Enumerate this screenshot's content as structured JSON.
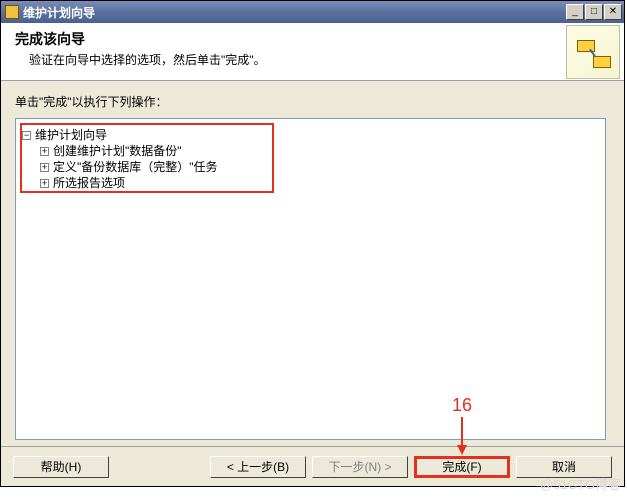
{
  "window": {
    "title": "维护计划向导"
  },
  "header": {
    "title": "完成该向导",
    "subtitle": "验证在向导中选择的选项，然后单击\"完成\"。"
  },
  "instruction": "单击\"完成\"以执行下列操作：",
  "tree": {
    "root": "维护计划向导",
    "items": [
      "创建维护计划\"数据备份\"",
      "定义\"备份数据库（完整）\"任务",
      "所选报告选项"
    ]
  },
  "buttons": {
    "help": "帮助(H)",
    "back": "< 上一步(B)",
    "next": "下一步(N) >",
    "finish": "完成(F)",
    "cancel": "取消"
  },
  "annotation": {
    "number": "16"
  },
  "watermark": "@51CTO博客"
}
